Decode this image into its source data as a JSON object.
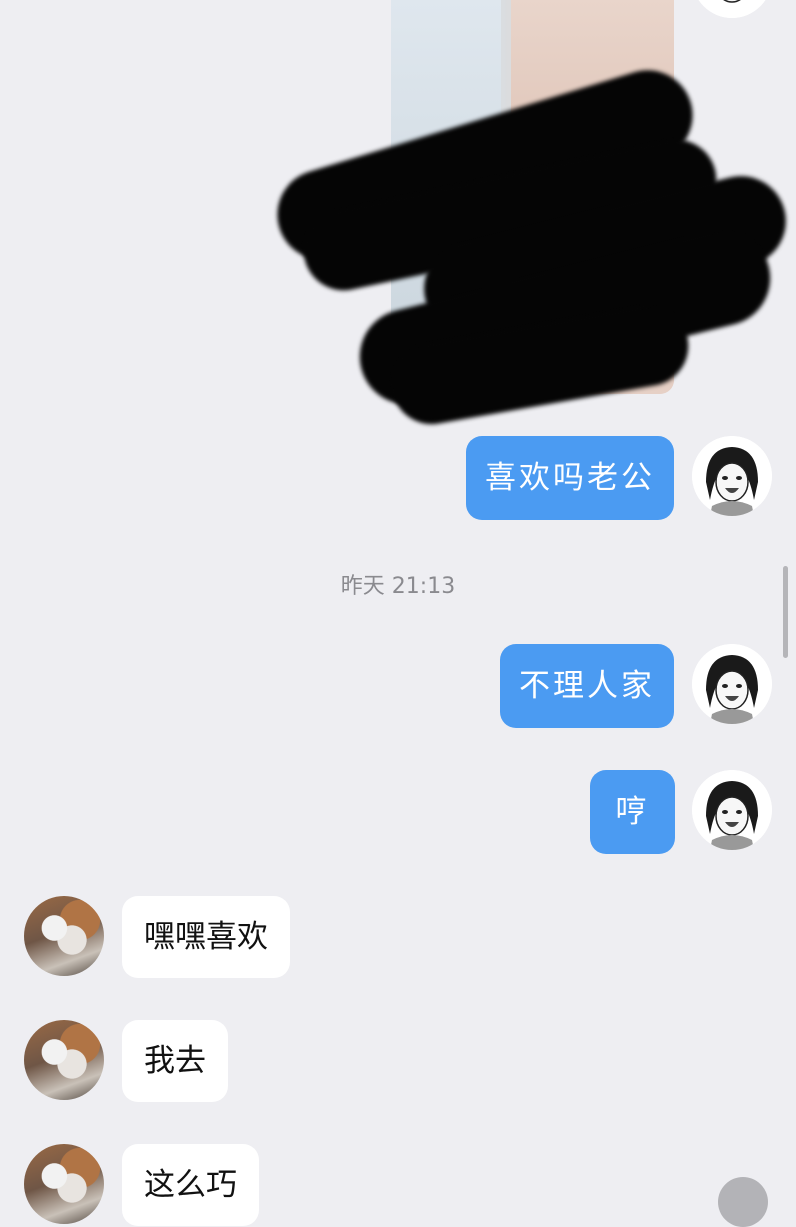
{
  "chat": {
    "timestamp": "昨天 21:13",
    "messages": [
      {
        "sender": "me",
        "type": "image"
      },
      {
        "sender": "me",
        "type": "text",
        "text": "喜欢吗老公"
      },
      {
        "sender": "me",
        "type": "text",
        "text": "不理人家"
      },
      {
        "sender": "me",
        "type": "text",
        "text": "哼"
      },
      {
        "sender": "them",
        "type": "text",
        "text": "嘿嘿喜欢"
      },
      {
        "sender": "them",
        "type": "text",
        "text": "我去"
      },
      {
        "sender": "them",
        "type": "text",
        "text": "这么巧"
      }
    ]
  },
  "avatars": {
    "me": "anime-girl-avatar",
    "them": "cat-photo-avatar"
  },
  "colors": {
    "background": "#eeeef2",
    "sent_bubble": "#4b9bf2",
    "received_bubble": "#ffffff",
    "timestamp_text": "#8a8a8f"
  }
}
